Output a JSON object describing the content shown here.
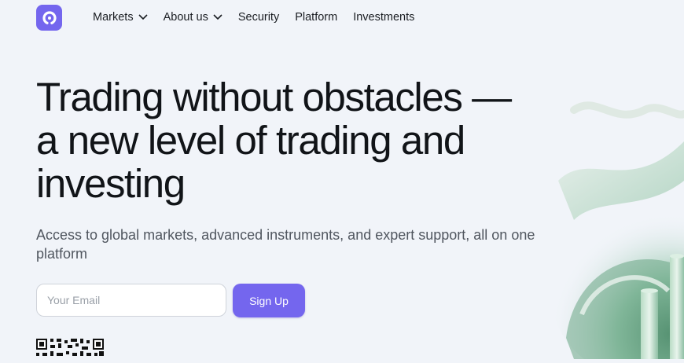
{
  "nav": {
    "logo_icon": "brand-logo-icon",
    "brand_color": "#7466ee",
    "items": [
      {
        "label": "Markets",
        "dropdown": true
      },
      {
        "label": "About us",
        "dropdown": true
      },
      {
        "label": "Security",
        "dropdown": false
      },
      {
        "label": "Platform",
        "dropdown": false
      },
      {
        "label": "Investments",
        "dropdown": false
      }
    ]
  },
  "hero": {
    "title_line1": "Trading without obstacles —",
    "title_line2": "a new level of trading and",
    "title_line3": "investing",
    "subtitle": "Access to global markets, advanced instruments, and expert support, all on one platform"
  },
  "signup": {
    "email_placeholder": "Your Email",
    "email_value": "",
    "button_label": "Sign Up"
  },
  "colors": {
    "background": "#f1f4f9",
    "accent": "#7466ee",
    "art_green": "#7fb79a"
  },
  "icons": {
    "qr": "qr-code-icon",
    "chevron": "chevron-down-icon"
  }
}
